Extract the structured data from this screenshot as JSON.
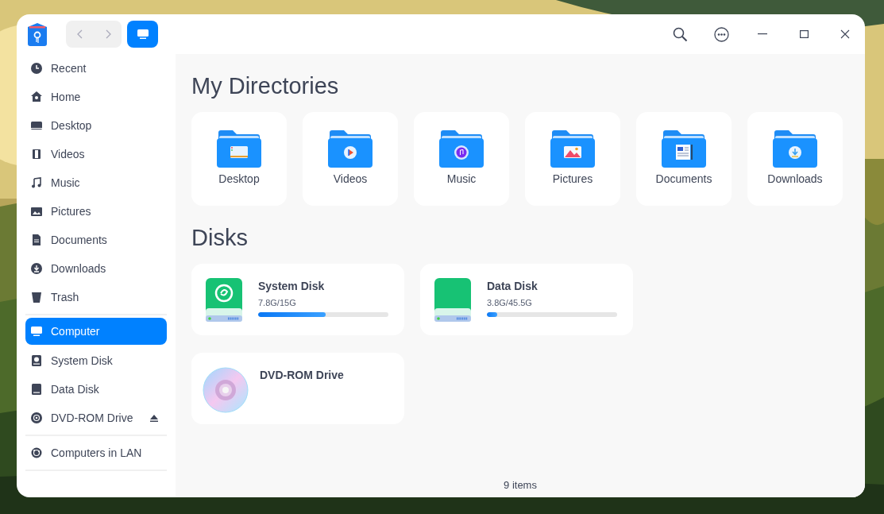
{
  "sidebar": {
    "groups": [
      {
        "items": [
          {
            "label": "Recent",
            "selected": false
          },
          {
            "label": "Home",
            "selected": false
          },
          {
            "label": "Desktop",
            "selected": false
          },
          {
            "label": "Videos",
            "selected": false
          },
          {
            "label": "Music",
            "selected": false
          },
          {
            "label": "Pictures",
            "selected": false
          },
          {
            "label": "Documents",
            "selected": false
          },
          {
            "label": "Downloads",
            "selected": false
          },
          {
            "label": "Trash",
            "selected": false
          }
        ]
      },
      {
        "items": [
          {
            "label": "Computer",
            "selected": true
          },
          {
            "label": "System Disk",
            "selected": false
          },
          {
            "label": "Data Disk",
            "selected": false
          },
          {
            "label": "DVD-ROM Drive",
            "selected": false,
            "ejectable": true
          }
        ]
      },
      {
        "items": [
          {
            "label": "Computers in LAN",
            "selected": false
          }
        ]
      }
    ]
  },
  "sections": [
    {
      "title": "My Directories",
      "kind": "folders",
      "items": [
        {
          "label": "Desktop"
        },
        {
          "label": "Videos"
        },
        {
          "label": "Music"
        },
        {
          "label": "Pictures"
        },
        {
          "label": "Documents"
        },
        {
          "label": "Downloads"
        }
      ]
    },
    {
      "title": "Disks",
      "kind": "disks",
      "items": [
        {
          "name": "System Disk",
          "kind": "system",
          "usage": "7.8G/15G",
          "level": 0.52
        },
        {
          "name": "Data Disk",
          "kind": "data",
          "usage": "3.8G/45.5G",
          "level": 0.08
        },
        {
          "name": "DVD-ROM Drive",
          "kind": "optical"
        }
      ]
    }
  ],
  "status_bar": "9 items"
}
